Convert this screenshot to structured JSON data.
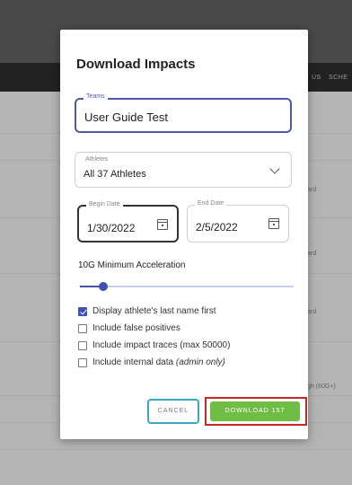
{
  "background": {
    "nav_items": [
      "US",
      "SCHE"
    ],
    "side_texts": [
      "ard",
      "ard",
      "ard",
      "gh (60G+)"
    ]
  },
  "modal": {
    "title": "Download Impacts",
    "teams": {
      "label": "Teams",
      "value": "User Guide Test"
    },
    "athletes": {
      "label": "Athletes",
      "value": "All 37 Athletes"
    },
    "begin_date": {
      "label": "Begin Date",
      "value": "1/30/2022"
    },
    "end_date": {
      "label": "End Date",
      "value": "2/5/2022"
    },
    "acceleration": {
      "label": "10G Minimum Acceleration",
      "slider_fraction": 0.11
    },
    "options": [
      {
        "label": "Display athlete's last name first",
        "checked": true,
        "note": ""
      },
      {
        "label": "Include false positives",
        "checked": false,
        "note": ""
      },
      {
        "label": "Include impact traces (max 50000)",
        "checked": false,
        "note": ""
      },
      {
        "label": "Include internal data",
        "checked": false,
        "note": "(admin only)"
      }
    ],
    "cancel_label": "CANCEL",
    "download_label": "DOWNLOAD 157"
  },
  "colors": {
    "accent": "#3f51b5",
    "download": "#6fbd45",
    "highlight": "#c62828",
    "cancel_border": "#3aa8c1"
  }
}
